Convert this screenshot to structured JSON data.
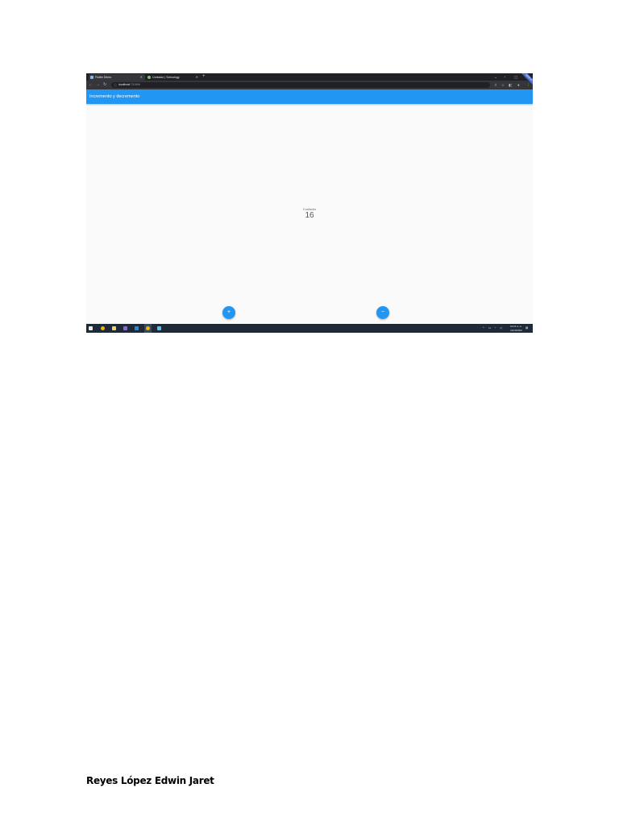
{
  "browser": {
    "tabs": [
      {
        "title": "Flutter Demo",
        "favicon_color": "#8ab4f8",
        "active": true
      },
      {
        "title": "Contador | Schoology",
        "favicon_color": "#7cc36b",
        "active": false
      }
    ],
    "new_tab": "+",
    "url_host": "localhost",
    "url_path": ":7319/#/",
    "window_controls": [
      "⌄",
      "–",
      "▢",
      "✕"
    ]
  },
  "app": {
    "title": "Incremento y decremento",
    "ribbon": "DEBUG",
    "counter_label": "Contador",
    "counter_value": "16",
    "increment_label": "+",
    "decrement_label": "−",
    "accent": "#2196f3"
  },
  "taskbar": {
    "clock_time": "10:21 a. m.",
    "clock_date": "11/10/2022"
  },
  "document": {
    "author": "Reyes López Edwin Jaret"
  }
}
